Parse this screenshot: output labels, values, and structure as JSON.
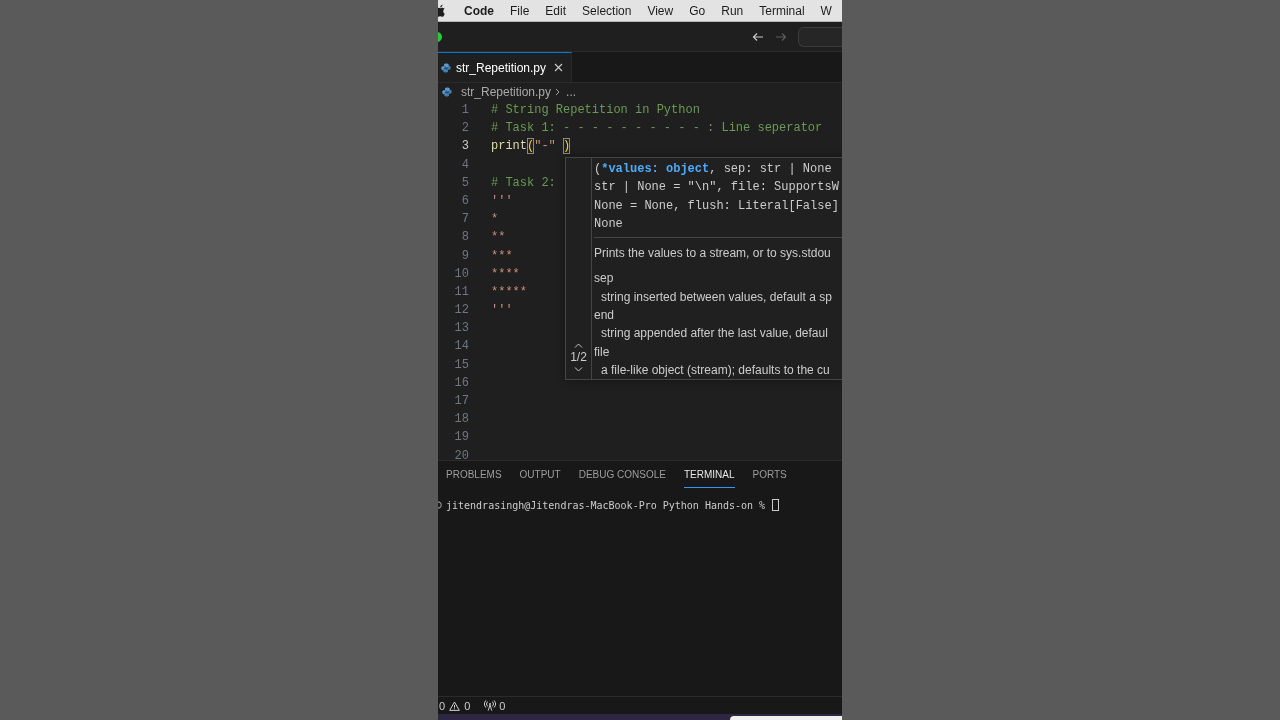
{
  "menu_bar": {
    "items": [
      {
        "kind": "app",
        "label": "Code"
      },
      {
        "kind": "menu",
        "label": "File"
      },
      {
        "kind": "menu",
        "label": "Edit"
      },
      {
        "kind": "menu",
        "label": "Selection"
      },
      {
        "kind": "menu",
        "label": "View"
      },
      {
        "kind": "menu",
        "label": "Go"
      },
      {
        "kind": "menu",
        "label": "Run"
      },
      {
        "kind": "menu",
        "label": "Terminal"
      },
      {
        "kind": "menu",
        "label": "W"
      }
    ]
  },
  "title_bar": {
    "nav_buttons": [
      {
        "kind": "back",
        "disabled": false
      },
      {
        "kind": "forward",
        "disabled": true
      }
    ]
  },
  "editor_tabs": [
    {
      "label": "str_Repetition.py",
      "selected": true
    }
  ],
  "breadcrumb": {
    "items": [
      {
        "kind": "file",
        "label": "str_Repetition.py"
      },
      {
        "kind": "symbol",
        "label": "..."
      }
    ]
  },
  "editor": {
    "lines": [
      {
        "number": "1",
        "active": false,
        "tokens": [
          {
            "kind": "comment",
            "text": "# String Repetition in Python"
          }
        ]
      },
      {
        "number": "2",
        "active": false,
        "tokens": [
          {
            "kind": "comment",
            "text": "# Task 1: - - - - - - - - - - : Line seperator"
          }
        ]
      },
      {
        "number": "3",
        "active": true,
        "tokens": [
          {
            "kind": "function",
            "text": "print"
          },
          {
            "kind": "bracket",
            "text": "("
          },
          {
            "kind": "string",
            "text": "\"-\" "
          },
          {
            "kind": "bracket",
            "text": ")"
          }
        ]
      },
      {
        "number": "4",
        "active": false
      },
      {
        "number": "5",
        "active": false,
        "tokens": [
          {
            "kind": "comment",
            "text": "# Task 2:"
          }
        ]
      },
      {
        "number": "6",
        "active": false,
        "tokens": [
          {
            "kind": "string",
            "text": "'''"
          }
        ]
      },
      {
        "number": "7",
        "active": false,
        "tokens": [
          {
            "kind": "string",
            "text": "*"
          }
        ]
      },
      {
        "number": "8",
        "active": false,
        "tokens": [
          {
            "kind": "string",
            "text": "**"
          }
        ]
      },
      {
        "number": "9",
        "active": false,
        "tokens": [
          {
            "kind": "string",
            "text": "***"
          }
        ]
      },
      {
        "number": "10",
        "active": false,
        "tokens": [
          {
            "kind": "string",
            "text": "****"
          }
        ]
      },
      {
        "number": "11",
        "active": false,
        "tokens": [
          {
            "kind": "string",
            "text": "*****"
          }
        ]
      },
      {
        "number": "12",
        "active": false,
        "tokens": [
          {
            "kind": "string",
            "text": "'''"
          }
        ]
      },
      {
        "number": "13",
        "active": false
      },
      {
        "number": "14",
        "active": false
      },
      {
        "number": "15",
        "active": false
      },
      {
        "number": "16",
        "active": false
      },
      {
        "number": "17",
        "active": false
      },
      {
        "number": "18",
        "active": false
      },
      {
        "number": "19",
        "active": false
      },
      {
        "number": "20",
        "active": false
      }
    ]
  },
  "parameter_hint": {
    "overload": "1/2",
    "signature": [
      [
        {
          "kind": "plain",
          "text": "("
        },
        {
          "kind": "active",
          "text": "*values: object"
        },
        {
          "kind": "plain",
          "text": ", sep: str | None"
        }
      ],
      [
        {
          "kind": "plain",
          "text": "str | None = \"\\n\", file: SupportsW"
        }
      ],
      [
        {
          "kind": "plain",
          "text": "None = None, flush: Literal[False]"
        }
      ],
      [
        {
          "kind": "plain",
          "text": "None"
        }
      ]
    ],
    "description": "Prints the values to a stream, or to sys.stdou",
    "params": [
      {
        "name": "sep",
        "description": "string inserted between values, default a sp"
      },
      {
        "name": "end",
        "description": "string appended after the last value, defaul"
      },
      {
        "name": "file",
        "description": "a file-like object (stream); defaults to the cu"
      }
    ]
  },
  "panel": {
    "tabs": [
      {
        "label": "PROBLEMS",
        "selected": false
      },
      {
        "label": "OUTPUT",
        "selected": false
      },
      {
        "label": "DEBUG CONSOLE",
        "selected": false
      },
      {
        "label": "TERMINAL",
        "selected": true
      },
      {
        "label": "PORTS",
        "selected": false
      }
    ],
    "terminal": {
      "prompt": "jitendrasingh@Jitendras-MacBook-Pro Python Hands-on %"
    }
  },
  "status_bar": {
    "errors": "0",
    "warnings": "0",
    "ports": "0"
  }
}
